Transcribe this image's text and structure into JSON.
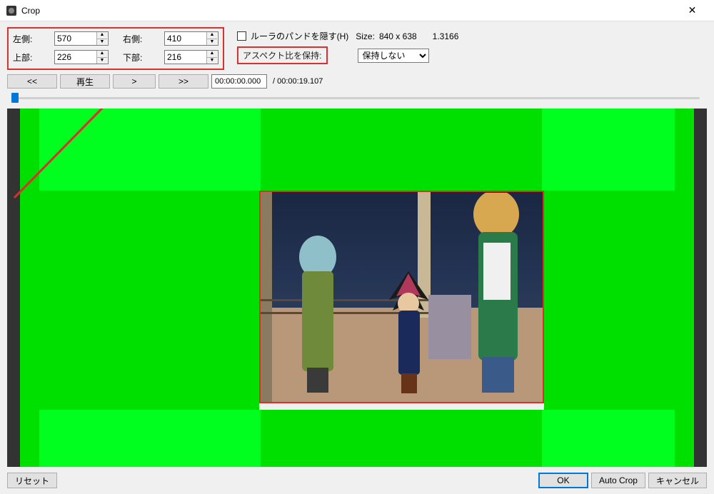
{
  "window": {
    "title": "Crop",
    "close": "✕"
  },
  "crop": {
    "left_label": "左側:",
    "left_value": "570",
    "right_label": "右側:",
    "right_value": "410",
    "top_label": "上部:",
    "top_value": "226",
    "bottom_label": "下部:",
    "bottom_value": "216"
  },
  "options": {
    "hide_ruler_checkbox": "ルーラのパンドを隠す(H)",
    "size_label": "Size:",
    "size_value": "840 x 638",
    "ratio_value": "1.3166",
    "aspect_label": "アスペクト比を保持:",
    "aspect_select": "保持しない"
  },
  "playback": {
    "rewind_fast": "<<",
    "play": "再生",
    "forward": ">",
    "forward_fast": ">>",
    "time_current": "00:00:00.000",
    "duration_sep": "/",
    "duration": "00:00:19.107"
  },
  "buttons": {
    "reset": "リセット",
    "ok": "OK",
    "auto_crop": "Auto Crop",
    "cancel": "キャンセル"
  }
}
